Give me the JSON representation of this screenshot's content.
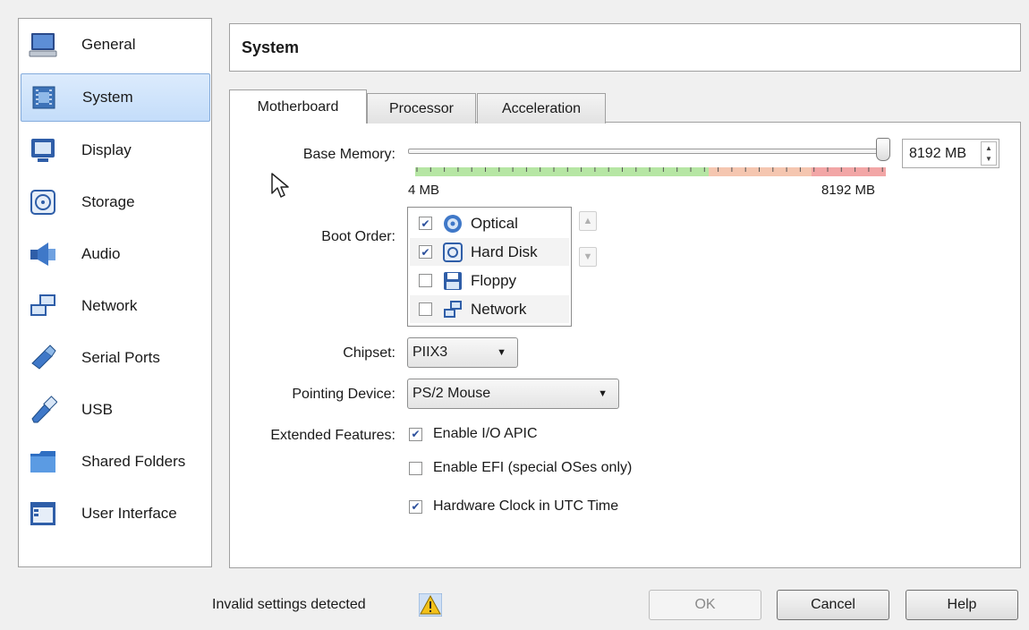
{
  "sidebar": {
    "items": [
      {
        "label": "General",
        "icon": "monitor-icon"
      },
      {
        "label": "System",
        "icon": "chip-icon",
        "selected": true
      },
      {
        "label": "Display",
        "icon": "display-icon"
      },
      {
        "label": "Storage",
        "icon": "disk-icon"
      },
      {
        "label": "Audio",
        "icon": "speaker-icon"
      },
      {
        "label": "Network",
        "icon": "network-icon"
      },
      {
        "label": "Serial Ports",
        "icon": "cable-icon"
      },
      {
        "label": "USB",
        "icon": "usb-icon"
      },
      {
        "label": "Shared Folders",
        "icon": "folder-icon"
      },
      {
        "label": "User Interface",
        "icon": "window-icon"
      }
    ]
  },
  "header": {
    "title": "System"
  },
  "tabs": [
    {
      "label": "Motherboard",
      "active": true
    },
    {
      "label": "Processor"
    },
    {
      "label": "Acceleration"
    }
  ],
  "motherboard": {
    "base_memory": {
      "label": "Base Memory:",
      "value": "8192 MB",
      "min_label": "4 MB",
      "max_label": "8192 MB",
      "slider_fraction": 1.0
    },
    "boot_order": {
      "label": "Boot Order:",
      "items": [
        {
          "label": "Optical",
          "checked": true
        },
        {
          "label": "Hard Disk",
          "checked": true
        },
        {
          "label": "Floppy",
          "checked": false
        },
        {
          "label": "Network",
          "checked": false
        }
      ]
    },
    "chipset": {
      "label": "Chipset:",
      "value": "PIIX3"
    },
    "pointing_device": {
      "label": "Pointing Device:",
      "value": "PS/2 Mouse"
    },
    "extended_features": {
      "label": "Extended Features:",
      "items": [
        {
          "label": "Enable I/O APIC",
          "checked": true
        },
        {
          "label": "Enable EFI (special OSes only)",
          "checked": false
        },
        {
          "label": "Hardware Clock in UTC Time",
          "checked": true
        }
      ]
    }
  },
  "footer": {
    "warning_text": "Invalid settings detected",
    "ok_label": "OK",
    "cancel_label": "Cancel",
    "help_label": "Help"
  },
  "colors": {
    "selection": "#c4ddfa",
    "scale_green": "#b6e6a4",
    "scale_orange": "#f5c6b0",
    "scale_red": "#f2a6a6",
    "check": "#2b4f9b"
  }
}
